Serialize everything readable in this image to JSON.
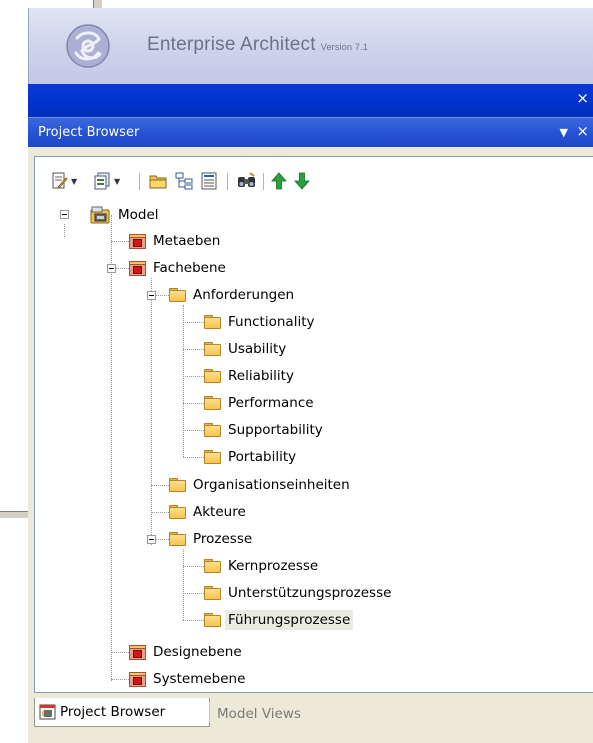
{
  "app": {
    "name": "Enterprise Architect",
    "version": "Version 7.1"
  },
  "window": {
    "outer_close": "×",
    "panel_title": "Project Browser",
    "dropdown": "▼",
    "close": "×"
  },
  "toolbar": {
    "buttons": [
      {
        "icon": "new-element-icon",
        "has_dropdown": true
      },
      {
        "icon": "new-diagram-icon",
        "has_dropdown": true
      },
      {
        "icon": "new-package-icon"
      },
      {
        "icon": "hierarchy-icon"
      },
      {
        "icon": "properties-icon"
      },
      {
        "icon": "find-binoculars-icon"
      },
      {
        "icon": "move-up-icon"
      },
      {
        "icon": "move-down-icon"
      }
    ],
    "colors": {
      "arrow_up": "#1f9c2b",
      "arrow_down": "#1f9c2b"
    }
  },
  "tree": {
    "root": "Model",
    "items": [
      {
        "label": "Metaeben",
        "type": "package"
      },
      {
        "label": "Fachebene",
        "type": "package"
      },
      {
        "label": "Anforderungen",
        "type": "folder"
      },
      {
        "label": "Functionality",
        "type": "folder"
      },
      {
        "label": "Usability",
        "type": "folder"
      },
      {
        "label": "Reliability",
        "type": "folder"
      },
      {
        "label": "Performance",
        "type": "folder"
      },
      {
        "label": "Supportability",
        "type": "folder"
      },
      {
        "label": "Portability",
        "type": "folder"
      },
      {
        "label": "Organisationseinheiten",
        "type": "folder"
      },
      {
        "label": "Akteure",
        "type": "folder"
      },
      {
        "label": "Prozesse",
        "type": "folder"
      },
      {
        "label": "Kernprozesse",
        "type": "folder"
      },
      {
        "label": "Unterstützungsprozesse",
        "type": "folder"
      },
      {
        "label": "Führungsprozesse",
        "type": "folder",
        "selected": true
      },
      {
        "label": "Designebene",
        "type": "package"
      },
      {
        "label": "Systemebene",
        "type": "package"
      }
    ]
  },
  "tabs": {
    "active": "Project Browser",
    "inactive": "Model Views"
  },
  "colors": {
    "caption_blue": "#0033cc",
    "header_lavender": "#cdd3ec",
    "selection": "#ecebe1"
  }
}
